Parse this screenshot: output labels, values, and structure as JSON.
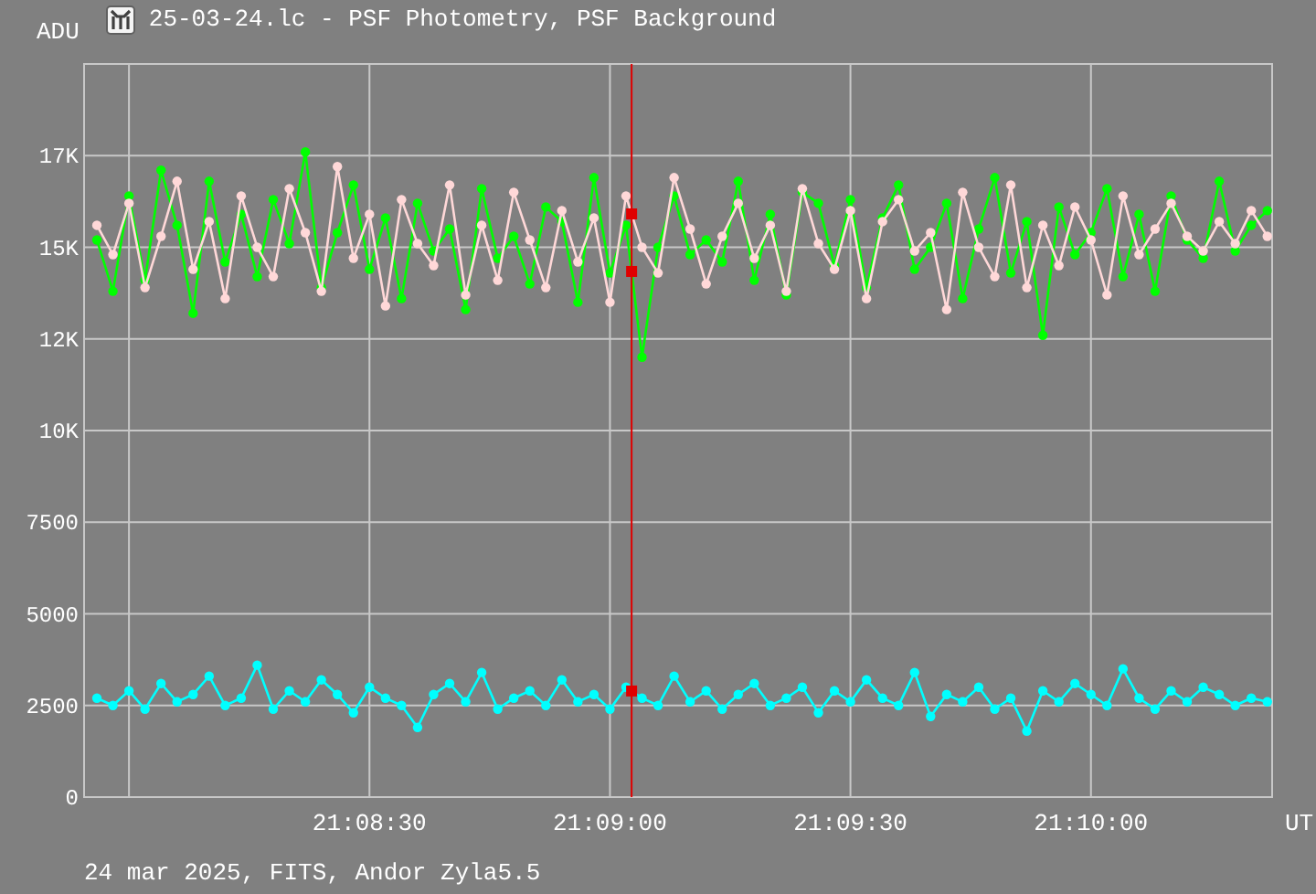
{
  "window": {
    "title": "25-03-24.lc - PSF Photometry, PSF Background"
  },
  "chart": {
    "chart_data": {
      "type": "line",
      "ylabel": "ADU",
      "xlabel": "UT",
      "xlim": [
        76074.4,
        76222.6
      ],
      "ylim": [
        0,
        20000
      ],
      "xticks": [
        {
          "value": 76110,
          "label": "21:08:30"
        },
        {
          "value": 76140,
          "label": "21:09:00"
        },
        {
          "value": 76170,
          "label": "21:09:30"
        },
        {
          "value": 76200,
          "label": "21:10:00"
        }
      ],
      "yticks": [
        0,
        2500,
        5000,
        7500,
        {
          "value": 10000,
          "label": "10K"
        },
        {
          "value": 12500,
          "label": "12K"
        },
        {
          "value": 15000,
          "label": "15K"
        },
        {
          "value": 17500,
          "label": "17K"
        }
      ],
      "x": [
        76076,
        76078,
        76080,
        76082,
        76084,
        76086,
        76088,
        76090,
        76092,
        76094,
        76096,
        76098,
        76100,
        76102,
        76104,
        76106,
        76108,
        76110,
        76112,
        76114,
        76116,
        76118,
        76120,
        76122,
        76124,
        76126,
        76128,
        76130,
        76132,
        76134,
        76136,
        76138,
        76140,
        76142,
        76144,
        76146,
        76148,
        76150,
        76152,
        76154,
        76156,
        76158,
        76160,
        76162,
        76164,
        76166,
        76168,
        76170,
        76172,
        76174,
        76176,
        76178,
        76180,
        76182,
        76184,
        76186,
        76188,
        76190,
        76192,
        76194,
        76196,
        76198,
        76200,
        76202,
        76204,
        76206,
        76208,
        76210,
        76212,
        76214,
        76216,
        76218,
        76220,
        76222
      ],
      "series": [
        {
          "color": "#00ff00",
          "marker": "circle",
          "values": [
            15200,
            13800,
            16400,
            14100,
            17100,
            15600,
            13200,
            16800,
            14600,
            15900,
            14200,
            16300,
            15100,
            17600,
            13900,
            15400,
            16700,
            14400,
            15800,
            13600,
            16200,
            14900,
            15500,
            13300,
            16600,
            14700,
            15300,
            14000,
            16100,
            15700,
            13500,
            16900,
            14300,
            15600,
            12000,
            15000,
            16400,
            14800,
            15200,
            14600,
            16800,
            14100,
            15900,
            13700,
            16500,
            16200,
            14500,
            16300,
            13900,
            15800,
            16700,
            14400,
            15000,
            16200,
            13600,
            15500,
            16900,
            14300,
            15700,
            12600,
            16100,
            14800,
            15400,
            16600,
            14200,
            15900,
            13800,
            16400,
            15200,
            14700,
            16800,
            14900,
            15600,
            16000
          ]
        },
        {
          "color": "#ffd8d8",
          "marker": "circle",
          "values": [
            15600,
            14800,
            16200,
            13900,
            15300,
            16800,
            14400,
            15700,
            13600,
            16400,
            15000,
            14200,
            16600,
            15400,
            13800,
            17200,
            14700,
            15900,
            13400,
            16300,
            15100,
            14500,
            16700,
            13700,
            15600,
            14100,
            16500,
            15200,
            13900,
            16000,
            14600,
            15800,
            13500,
            16400,
            15000,
            14300,
            16900,
            15500,
            14000,
            15300,
            16200,
            14700,
            15600,
            13800,
            16600,
            15100,
            14400,
            16000,
            13600,
            15700,
            16300,
            14900,
            15400,
            13300,
            16500,
            15000,
            14200,
            16700,
            13900,
            15600,
            14500,
            16100,
            15200,
            13700,
            16400,
            14800,
            15500,
            16200,
            15300,
            14900,
            15700,
            15100,
            16000,
            15300
          ]
        },
        {
          "color": "#00ffff",
          "marker": "circle",
          "values": [
            2700,
            2500,
            2900,
            2400,
            3100,
            2600,
            2800,
            3300,
            2500,
            2700,
            3600,
            2400,
            2900,
            2600,
            3200,
            2800,
            2300,
            3000,
            2700,
            2500,
            1900,
            2800,
            3100,
            2600,
            3400,
            2400,
            2700,
            2900,
            2500,
            3200,
            2600,
            2800,
            2400,
            3000,
            2700,
            2500,
            3300,
            2600,
            2900,
            2400,
            2800,
            3100,
            2500,
            2700,
            3000,
            2300,
            2900,
            2600,
            3200,
            2700,
            2500,
            3400,
            2200,
            2800,
            2600,
            3000,
            2400,
            2700,
            1800,
            2900,
            2600,
            3100,
            2800,
            2500,
            3500,
            2700,
            2400,
            2900,
            2600,
            3000,
            2800,
            2500,
            2700,
            2600
          ]
        }
      ],
      "grid": true,
      "ref_lines": [
        {
          "axis": "x",
          "value": 76142.7,
          "color": "#e00000"
        }
      ]
    }
  },
  "footer": "24 mar 2025, FITS, Andor Zyla5.5"
}
